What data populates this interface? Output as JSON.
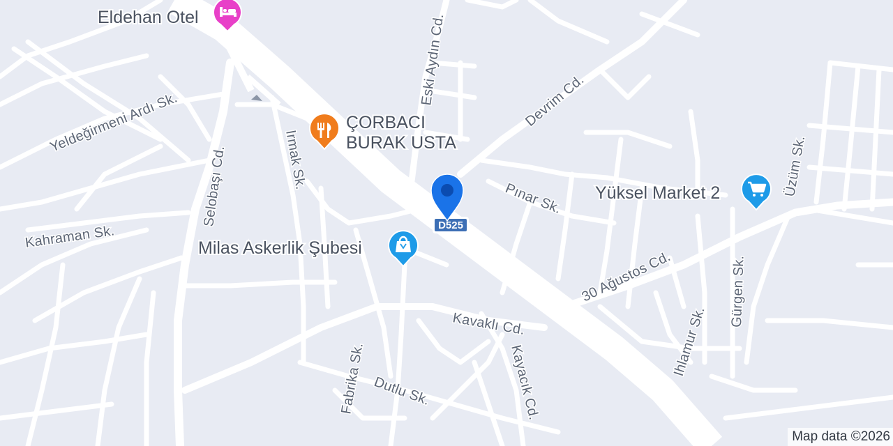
{
  "map": {
    "background_color": "#e8ebf3",
    "road_color": "#ffffff",
    "label_color": "#5d6676"
  },
  "streets": {
    "yeldegirmeni": "Yeldeğirmeni Ardı Sk.",
    "selobasi": "Selobaşı Cd.",
    "kahraman": "Kahraman Sk.",
    "irmak": "Irmak Sk.",
    "eski_aydin": "Eski Aydın Cd.",
    "devrim": "Devrim Cd.",
    "pinar": "Pınar Sk.",
    "uzum": "Üzüm Sk.",
    "otuz_agustos": "30 Ağustos Cd.",
    "gurgen": "Gürgen Sk.",
    "ihlamur": "Ihlamur Sk.",
    "kavakli": "Kavaklı Cd.",
    "kayacik": "Kayacık Cd.",
    "fabrika": "Fabrika Sk.",
    "dutlu": "Dutlu Sk."
  },
  "pois": [
    {
      "label": "Eldehan Otel",
      "icon": "hotel-bed-icon",
      "color": "#e840c8"
    },
    {
      "label_line1": "ÇORBACI",
      "label_line2": "BURAK USTA",
      "icon": "restaurant-fork-knife-icon",
      "color": "#f07c1c"
    },
    {
      "label": "Milas Askerlik Şubesi",
      "icon": "shopping-bag-icon",
      "color": "#1e9be8"
    },
    {
      "label": "Yüksel Market 2",
      "icon": "shopping-cart-icon",
      "color": "#1e9be8"
    }
  ],
  "highway_shield": {
    "label": "D525",
    "color": "#3d6fb5"
  },
  "location_pin": {
    "icon": "location-pin-icon",
    "color": "#1a73e8"
  },
  "attribution": "Map data ©2026"
}
